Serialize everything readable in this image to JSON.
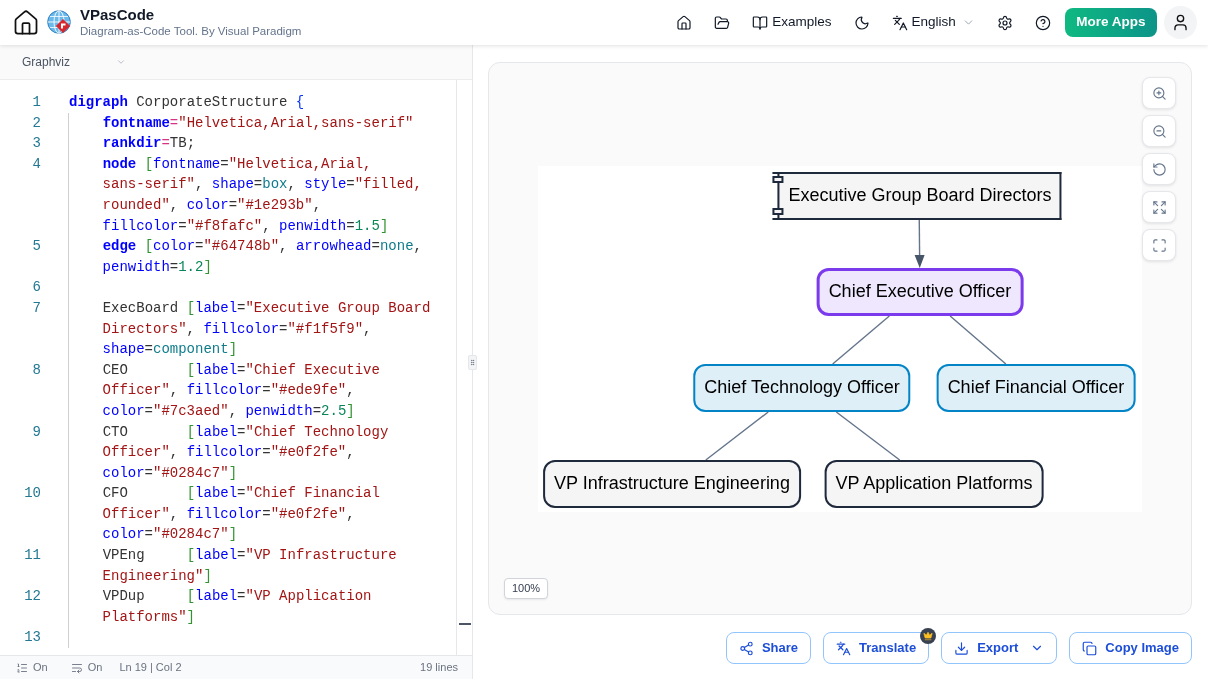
{
  "header": {
    "app_name": "VPasCode",
    "tagline": "Diagram-as-Code Tool. By Visual Paradigm",
    "examples_label": "Examples",
    "language": "English",
    "more_apps": "More Apps"
  },
  "editor": {
    "diagram_type": "Graphviz",
    "lines": [
      {
        "number": "1",
        "tokens": [
          {
            "kind": "keyword",
            "text": "digraph"
          },
          {
            "kind": "plain",
            "text": " CorporateStructure "
          },
          {
            "kind": "brace",
            "text": "{"
          }
        ]
      },
      {
        "number": "2",
        "tokens": [
          {
            "kind": "keyword",
            "text": "    fontname"
          },
          {
            "kind": "operator",
            "text": "="
          },
          {
            "kind": "string",
            "text": "\"Helvetica,Arial,sans-serif\""
          }
        ]
      },
      {
        "number": "3",
        "tokens": [
          {
            "kind": "keyword",
            "text": "    rankdir"
          },
          {
            "kind": "operator",
            "text": "="
          },
          {
            "kind": "plain",
            "text": "TB;"
          }
        ]
      },
      {
        "number": "4",
        "tokens": [
          {
            "kind": "keyword",
            "text": "    node"
          },
          {
            "kind": "bracket",
            "text": " ["
          },
          {
            "kind": "attr",
            "text": "fontname"
          },
          {
            "kind": "plain",
            "text": "="
          },
          {
            "kind": "string",
            "text": "\"Helvetica,Arial,sans-serif\""
          },
          {
            "kind": "plain",
            "text": ", "
          },
          {
            "kind": "attr",
            "text": "shape"
          },
          {
            "kind": "plain",
            "text": "="
          },
          {
            "kind": "value",
            "text": "box"
          },
          {
            "kind": "plain",
            "text": ", "
          },
          {
            "kind": "attr",
            "text": "style"
          },
          {
            "kind": "plain",
            "text": "="
          },
          {
            "kind": "string",
            "text": "\"filled,rounded\""
          },
          {
            "kind": "plain",
            "text": ", "
          },
          {
            "kind": "attr",
            "text": "color"
          },
          {
            "kind": "plain",
            "text": "="
          },
          {
            "kind": "string",
            "text": "\"#1e293b\""
          },
          {
            "kind": "plain",
            "text": ", "
          },
          {
            "kind": "attr",
            "text": "fillcolor"
          },
          {
            "kind": "plain",
            "text": "="
          },
          {
            "kind": "string",
            "text": "\"#f8fafc\""
          },
          {
            "kind": "plain",
            "text": ", "
          },
          {
            "kind": "attr",
            "text": "penwidth"
          },
          {
            "kind": "plain",
            "text": "="
          },
          {
            "kind": "number",
            "text": "1.5"
          },
          {
            "kind": "bracket",
            "text": "]"
          }
        ]
      },
      {
        "number": "5",
        "tokens": [
          {
            "kind": "keyword",
            "text": "    edge"
          },
          {
            "kind": "bracket",
            "text": " ["
          },
          {
            "kind": "attr",
            "text": "color"
          },
          {
            "kind": "plain",
            "text": "="
          },
          {
            "kind": "string",
            "text": "\"#64748b\""
          },
          {
            "kind": "plain",
            "text": ", "
          },
          {
            "kind": "attr",
            "text": "arrowhead"
          },
          {
            "kind": "plain",
            "text": "="
          },
          {
            "kind": "value",
            "text": "none"
          },
          {
            "kind": "plain",
            "text": ", "
          },
          {
            "kind": "attr",
            "text": "penwidth"
          },
          {
            "kind": "plain",
            "text": "="
          },
          {
            "kind": "number",
            "text": "1.2"
          },
          {
            "kind": "bracket",
            "text": "]"
          }
        ]
      },
      {
        "number": "6"
      },
      {
        "number": "7",
        "tokens": [
          {
            "kind": "plain",
            "text": "    ExecBoard "
          },
          {
            "kind": "bracket",
            "text": "["
          },
          {
            "kind": "attr",
            "text": "label"
          },
          {
            "kind": "plain",
            "text": "="
          },
          {
            "kind": "string",
            "text": "\"Executive Group Board Directors\""
          },
          {
            "kind": "plain",
            "text": ", "
          },
          {
            "kind": "attr",
            "text": "fillcolor"
          },
          {
            "kind": "plain",
            "text": "="
          },
          {
            "kind": "string",
            "text": "\"#f1f5f9\""
          },
          {
            "kind": "plain",
            "text": ", "
          },
          {
            "kind": "attr",
            "text": "shape"
          },
          {
            "kind": "plain",
            "text": "="
          },
          {
            "kind": "value",
            "text": "component"
          },
          {
            "kind": "bracket",
            "text": "]"
          }
        ]
      },
      {
        "number": "8",
        "tokens": [
          {
            "kind": "plain",
            "text": "    CEO       "
          },
          {
            "kind": "bracket",
            "text": "["
          },
          {
            "kind": "attr",
            "text": "label"
          },
          {
            "kind": "plain",
            "text": "="
          },
          {
            "kind": "string",
            "text": "\"Chief Executive Officer\""
          },
          {
            "kind": "plain",
            "text": ", "
          },
          {
            "kind": "attr",
            "text": "fillcolor"
          },
          {
            "kind": "plain",
            "text": "="
          },
          {
            "kind": "string",
            "text": "\"#ede9fe\""
          },
          {
            "kind": "plain",
            "text": ", "
          },
          {
            "kind": "attr",
            "text": "color"
          },
          {
            "kind": "plain",
            "text": "="
          },
          {
            "kind": "string",
            "text": "\"#7c3aed\""
          },
          {
            "kind": "plain",
            "text": ", "
          },
          {
            "kind": "attr",
            "text": "penwidth"
          },
          {
            "kind": "plain",
            "text": "="
          },
          {
            "kind": "number",
            "text": "2.5"
          },
          {
            "kind": "bracket",
            "text": "]"
          }
        ]
      },
      {
        "number": "9",
        "tokens": [
          {
            "kind": "plain",
            "text": "    CTO       "
          },
          {
            "kind": "bracket",
            "text": "["
          },
          {
            "kind": "attr",
            "text": "label"
          },
          {
            "kind": "plain",
            "text": "="
          },
          {
            "kind": "string",
            "text": "\"Chief Technology Officer\""
          },
          {
            "kind": "plain",
            "text": ", "
          },
          {
            "kind": "attr",
            "text": "fillcolor"
          },
          {
            "kind": "plain",
            "text": "="
          },
          {
            "kind": "string",
            "text": "\"#e0f2fe\""
          },
          {
            "kind": "plain",
            "text": ", "
          },
          {
            "kind": "attr",
            "text": "color"
          },
          {
            "kind": "plain",
            "text": "="
          },
          {
            "kind": "string",
            "text": "\"#0284c7\""
          },
          {
            "kind": "bracket",
            "text": "]"
          }
        ]
      },
      {
        "number": "10",
        "tokens": [
          {
            "kind": "plain",
            "text": "    CFO       "
          },
          {
            "kind": "bracket",
            "text": "["
          },
          {
            "kind": "attr",
            "text": "label"
          },
          {
            "kind": "plain",
            "text": "="
          },
          {
            "kind": "string",
            "text": "\"Chief Financial Officer\""
          },
          {
            "kind": "plain",
            "text": ", "
          },
          {
            "kind": "attr",
            "text": "fillcolor"
          },
          {
            "kind": "plain",
            "text": "="
          },
          {
            "kind": "string",
            "text": "\"#e0f2fe\""
          },
          {
            "kind": "plain",
            "text": ", "
          },
          {
            "kind": "attr",
            "text": "color"
          },
          {
            "kind": "plain",
            "text": "="
          },
          {
            "kind": "string",
            "text": "\"#0284c7\""
          },
          {
            "kind": "bracket",
            "text": "]"
          }
        ]
      },
      {
        "number": "11",
        "tokens": [
          {
            "kind": "plain",
            "text": "    VPEng     "
          },
          {
            "kind": "bracket",
            "text": "["
          },
          {
            "kind": "attr",
            "text": "label"
          },
          {
            "kind": "plain",
            "text": "="
          },
          {
            "kind": "string",
            "text": "\"VP Infrastructure Engineering\""
          },
          {
            "kind": "bracket",
            "text": "]"
          }
        ]
      },
      {
        "number": "12",
        "tokens": [
          {
            "kind": "plain",
            "text": "    VPDup     "
          },
          {
            "kind": "bracket",
            "text": "["
          },
          {
            "kind": "attr",
            "text": "label"
          },
          {
            "kind": "plain",
            "text": "="
          },
          {
            "kind": "string",
            "text": "\"VP Application Platforms\""
          },
          {
            "kind": "bracket",
            "text": "]"
          }
        ]
      },
      {
        "number": "13"
      }
    ],
    "status_bar": {
      "line_numbers": "On",
      "word_wrap": "On",
      "cursor_position": "Ln 19 | Col 2",
      "line_count": "19 lines"
    }
  },
  "preview": {
    "zoom_level": "100%",
    "diagram": {
      "nodes": [
        {
          "label": "Executive Group Board Directors",
          "kind": "component",
          "color": "#1e293b",
          "thick": false,
          "children": [
            {
              "label": "Chief Executive Officer",
              "kind": "box",
              "color": "#7c3aed",
              "thick": true,
              "arrowhead": true,
              "children": [
                {
                  "label": "Chief Technology Officer",
                  "kind": "box",
                  "color": "#0284c7",
                  "thick": false,
                  "arrowhead": false,
                  "children": [
                    {
                      "label": "VP Infrastructure Engineering",
                      "kind": "box",
                      "color": "#1e293b",
                      "thick": false,
                      "arrowhead": false
                    },
                    {
                      "label": "VP Application Platforms",
                      "kind": "box",
                      "color": "#1e293b",
                      "thick": false,
                      "arrowhead": false
                    }
                  ]
                },
                {
                  "label": "Chief Financial Officer",
                  "kind": "box",
                  "color": "#0284c7",
                  "thick": false,
                  "arrowhead": false
                }
              ]
            }
          ]
        }
      ]
    }
  },
  "actions": [
    {
      "kind": "share",
      "label": "Share",
      "premium": false,
      "dropdown": false
    },
    {
      "kind": "translate",
      "label": "Translate",
      "premium": true,
      "dropdown": false
    },
    {
      "kind": "export",
      "label": "Export",
      "premium": false,
      "dropdown": true
    },
    {
      "kind": "copy",
      "label": "Copy Image",
      "premium": false,
      "dropdown": false
    }
  ]
}
